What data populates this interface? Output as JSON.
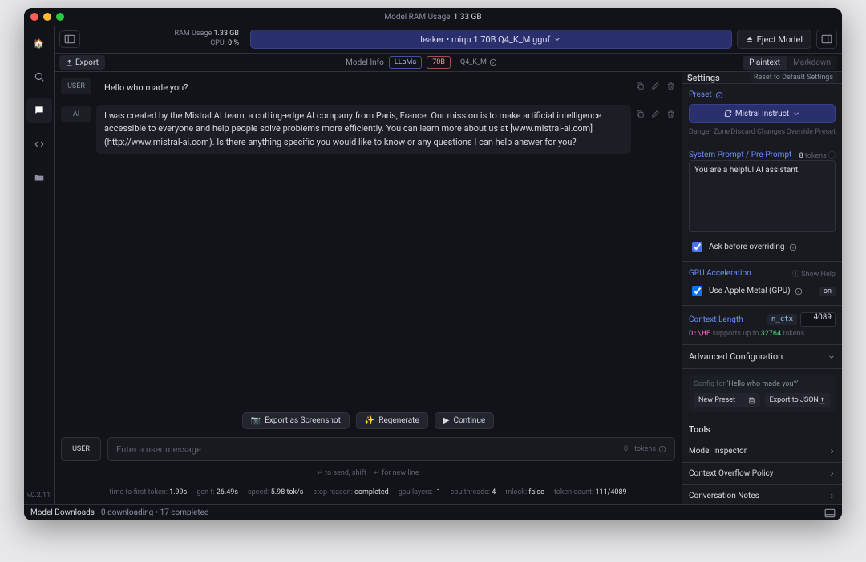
{
  "titlebar": {
    "label": "Model RAM Usage",
    "value": "1.33 GB"
  },
  "sidebar": {
    "version": "v0.2.11"
  },
  "topbar": {
    "ram_label": "RAM Usage",
    "ram_value": "1.33 GB",
    "cpu_label": "CPU:",
    "cpu_value": "0 %",
    "model": "leaker • miqu 1 70B Q4_K_M gguf",
    "eject": "Eject Model"
  },
  "subbar": {
    "export": "Export",
    "model_info": "Model Info",
    "tag_llama": "LLaMa",
    "tag_size": "70B",
    "tag_quant": "Q4_K_M",
    "view_plain": "Plaintext",
    "view_md": "Markdown"
  },
  "chat": {
    "msgs": [
      {
        "role": "USER",
        "text": "Hello who made you?"
      },
      {
        "role": "AI",
        "text": "I was created by the Mistral AI team, a cutting-edge AI company from Paris, France. Our mission is to make artificial intelligence accessible to everyone and help people solve problems more efficiently. You can learn more about us at [www.mistral-ai.com](http://www.mistral-ai.com). Is there anything specific you would like to know or any questions I can help answer for you?"
      }
    ],
    "screenshot_btn": "Export as Screenshot",
    "regen_btn": "Regenerate",
    "continue_btn": "Continue",
    "input_role": "USER",
    "input_placeholder": "Enter a user message ...",
    "input_tokens": "0",
    "input_tokens_unit": "tokens",
    "hint": "↵ to send, shift + ↵ for new line"
  },
  "stats": {
    "ttft_l": "time to first token:",
    "ttft_v": "1.99s",
    "gen_l": "gen t:",
    "gen_v": "26.49s",
    "spd_l": "speed:",
    "spd_v": "5.98 tok/s",
    "stop_l": "stop reason:",
    "stop_v": "completed",
    "gpu_l": "gpu layers:",
    "gpu_v": "-1",
    "cpu_l": "cpu threads:",
    "cpu_v": "4",
    "mlock_l": "mlock:",
    "mlock_v": "false",
    "tok_l": "token count:",
    "tok_v": "111/4089"
  },
  "settings": {
    "title": "Settings",
    "reset": "Reset to Default Settings",
    "preset_label": "Preset",
    "preset_value": "Mistral Instruct",
    "danger": "Danger Zone",
    "discard": "Discard Changes",
    "override": "Override Preset",
    "sys_label": "System Prompt / Pre-Prompt",
    "sys_tokens": "8",
    "sys_tokens_unit": "tokens",
    "sys_value": "You are a helpful AI assistant.",
    "ask_override": "Ask before overriding",
    "gpu_label": "GPU Acceleration",
    "show_help": "Show Help",
    "use_metal": "Use Apple Metal (GPU)",
    "gpu_on": "on",
    "ctx_label": "Context Length",
    "ctx_mono": "n_ctx",
    "ctx_value": "4089",
    "ctx_hint_pre": "D:\\HF",
    "ctx_hint_mid": "supports up to",
    "ctx_hint_num": "32764",
    "ctx_hint_post": "tokens.",
    "adv": "Advanced Configuration",
    "cfg_for": "Config for",
    "cfg_q": "'Hello who made you?'",
    "new_preset": "New Preset",
    "export_json": "Export to JSON",
    "tools": "Tools",
    "tool1": "Model Inspector",
    "tool2": "Context Overflow Policy",
    "tool3": "Conversation Notes"
  },
  "footer": {
    "title": "Model Downloads",
    "status": "0 downloading • 17 completed"
  }
}
